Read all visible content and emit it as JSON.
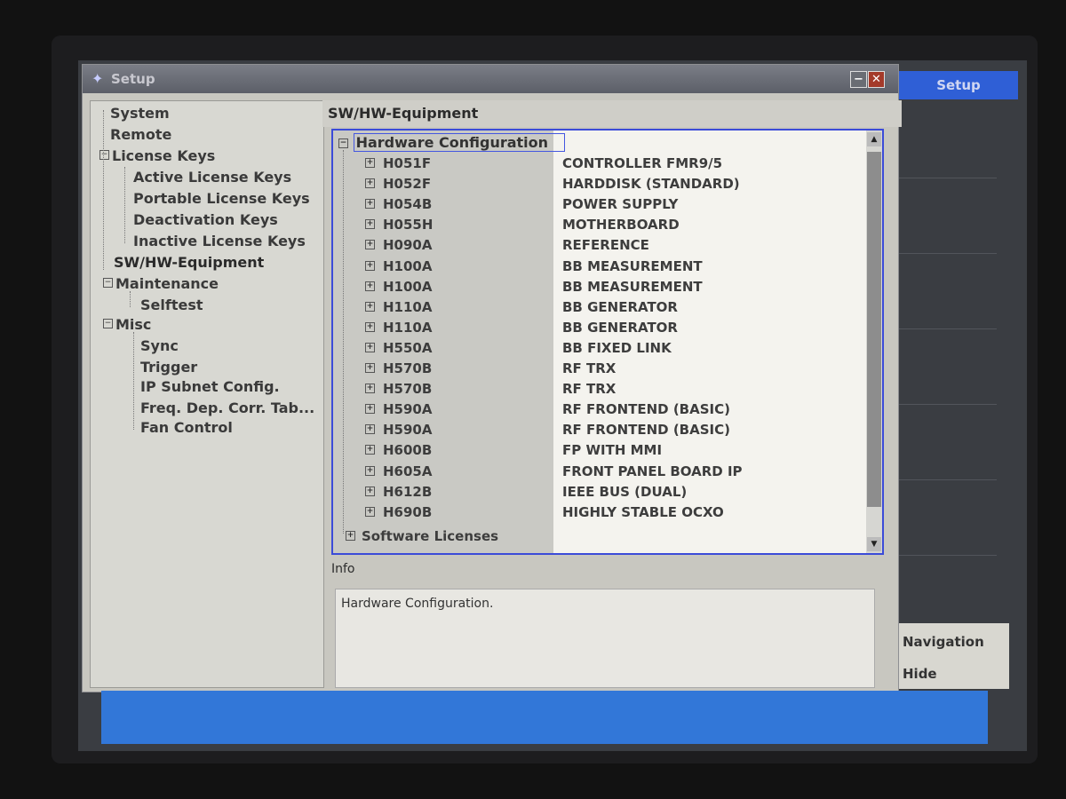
{
  "window": {
    "title": "Setup",
    "minimize_symbol": "−",
    "close_symbol": "✕"
  },
  "nav": {
    "items": [
      {
        "label": "System",
        "level": 1
      },
      {
        "label": "Remote",
        "level": 1
      },
      {
        "label": "License Keys",
        "level": 1,
        "expander": "−"
      },
      {
        "label": "Active License Keys",
        "level": 2
      },
      {
        "label": "Portable License Keys",
        "level": 2
      },
      {
        "label": "Deactivation Keys",
        "level": 2
      },
      {
        "label": "Inactive License Keys",
        "level": 2
      },
      {
        "label": "SW/HW-Equipment",
        "level": 1,
        "selected": true
      },
      {
        "label": "Maintenance",
        "level": 1,
        "expander": "−"
      },
      {
        "label": "Selftest",
        "level": 2
      },
      {
        "label": "Misc",
        "level": 1,
        "expander": "−"
      },
      {
        "label": "Sync",
        "level": 2
      },
      {
        "label": "Trigger",
        "level": 2
      },
      {
        "label": "IP Subnet Config.",
        "level": 2
      },
      {
        "label": "Freq. Dep. Corr. Tab...",
        "level": 2
      },
      {
        "label": "Fan Control",
        "level": 2
      }
    ]
  },
  "content": {
    "section_title": "SW/HW-Equipment",
    "root_label": "Hardware Configuration",
    "rows": [
      {
        "code": "H051F",
        "desc": "CONTROLLER FMR9/5"
      },
      {
        "code": "H052F",
        "desc": "HARDDISK (STANDARD)"
      },
      {
        "code": "H054B",
        "desc": "POWER SUPPLY"
      },
      {
        "code": "H055H",
        "desc": "MOTHERBOARD"
      },
      {
        "code": "H090A",
        "desc": "REFERENCE"
      },
      {
        "code": "H100A",
        "desc": "BB MEASUREMENT"
      },
      {
        "code": "H100A",
        "desc": "BB MEASUREMENT"
      },
      {
        "code": "H110A",
        "desc": "BB GENERATOR"
      },
      {
        "code": "H110A",
        "desc": "BB GENERATOR"
      },
      {
        "code": "H550A",
        "desc": "BB FIXED LINK"
      },
      {
        "code": "H570B",
        "desc": "RF TRX"
      },
      {
        "code": "H570B",
        "desc": "RF TRX"
      },
      {
        "code": "H590A",
        "desc": "RF FRONTEND (BASIC)"
      },
      {
        "code": "H590A",
        "desc": "RF FRONTEND (BASIC)"
      },
      {
        "code": "H600B",
        "desc": "FP WITH MMI"
      },
      {
        "code": "H605A",
        "desc": "FRONT PANEL BOARD IP"
      },
      {
        "code": "H612B",
        "desc": "IEEE BUS (DUAL)"
      },
      {
        "code": "H690B",
        "desc": "HIGHLY STABLE OCXO"
      }
    ],
    "software_label": "Software Licenses",
    "info_label": "Info",
    "info_text": "Hardware Configuration."
  },
  "softkeys": {
    "setup": "Setup",
    "navigation": "Navigation",
    "hide": "Hide"
  },
  "colors": {
    "accent_blue": "#3b4bd8",
    "softkey_blue": "#2f5fd6",
    "bottom_bar": "#3277d8"
  }
}
